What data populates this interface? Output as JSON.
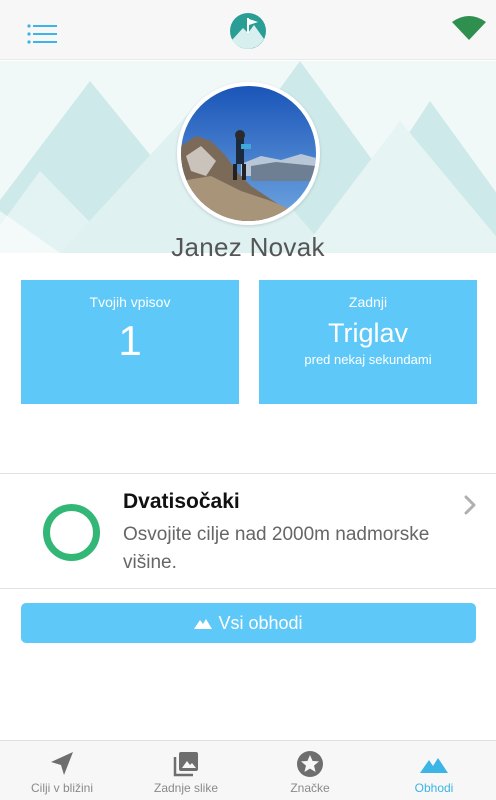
{
  "header": {
    "menu_icon": "hamburger-list-icon",
    "logo_icon": "mountain-flag-logo-icon",
    "status_icon": "wifi-signal-icon"
  },
  "profile": {
    "name": "Janez Novak",
    "avatar_alt": "profile photo"
  },
  "stats": {
    "entries_label": "Tvojih vpisov",
    "entries_value": "1",
    "last_label": "Zadnji",
    "last_peak": "Triglav",
    "last_time": "pred nekaj sekundami"
  },
  "challenge": {
    "title": "Dvatisočaki",
    "description": "Osvojite cilje nad 2000m nadmorske višine.",
    "progress": 0
  },
  "all_button": {
    "label": "Vsi obhodi",
    "icon": "mountain-icon"
  },
  "bottom_nav": {
    "items": [
      {
        "label": "Cilji v bližini",
        "icon": "navigation-arrow-icon"
      },
      {
        "label": "Zadnje slike",
        "icon": "photo-gallery-icon"
      },
      {
        "label": "Značke",
        "icon": "star-badge-icon"
      },
      {
        "label": "Obhodi",
        "icon": "mountain-icon"
      }
    ],
    "active_index": 3
  },
  "colors": {
    "accent": "#5ec8f8",
    "active_tab": "#3bb4e6",
    "progress_ring": "#33b777",
    "logo_teal": "#2a9d95",
    "wifi_green": "#2f8f4e"
  }
}
